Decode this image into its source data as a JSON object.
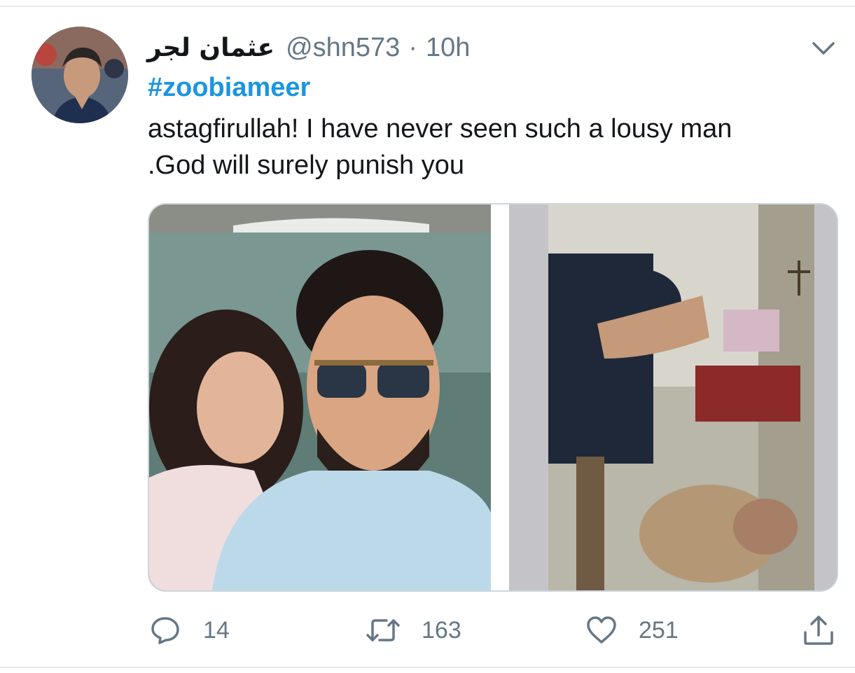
{
  "tweet": {
    "display_name": "عثمان لجر",
    "handle": "@shn573",
    "separator": "·",
    "time": "10h",
    "hashtag": "#zoobiameer",
    "body_line1": "astagfirullah! I have never seen such a lousy man",
    "body_line2": ".God will surely punish you",
    "media_alt": "tweet-media-collage"
  },
  "actions": {
    "reply_count": "14",
    "retweet_count": "163",
    "like_count": "251"
  },
  "icons": {
    "caret": "chevron-down-icon",
    "reply": "reply-icon",
    "retweet": "retweet-icon",
    "like": "heart-icon",
    "share": "share-icon"
  },
  "colors": {
    "link": "#1b95e0",
    "muted": "#657786",
    "text": "#14171a",
    "divider": "#e6ecf0"
  }
}
